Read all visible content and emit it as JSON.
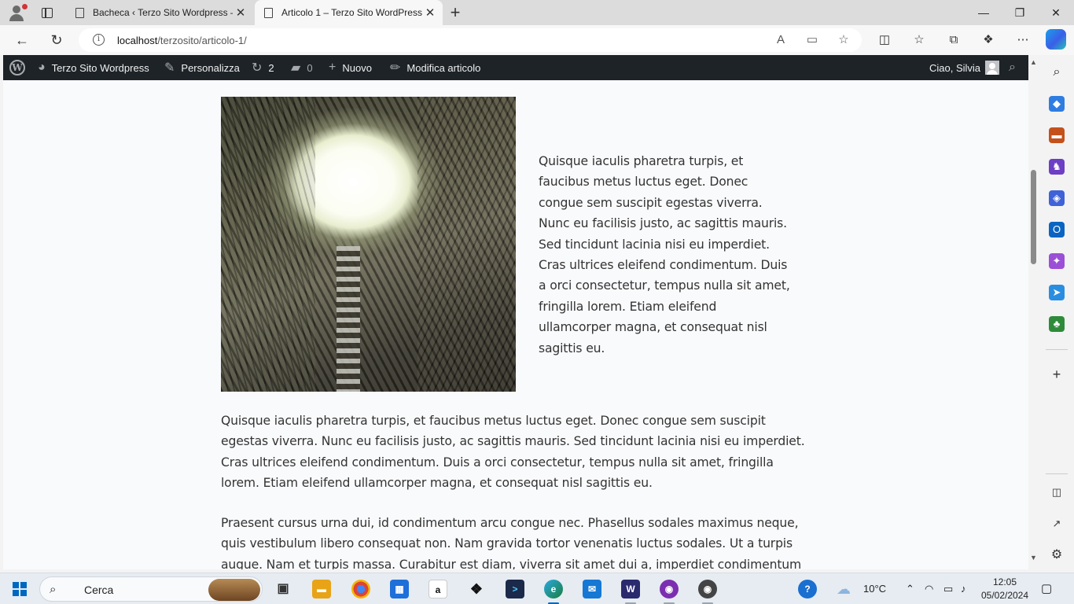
{
  "browser": {
    "tabs": [
      {
        "title": "Bacheca ‹ Terzo Sito Wordpress — "
      },
      {
        "title": "Articolo 1 – Terzo Sito WordPress"
      }
    ],
    "url_host": "localhost",
    "url_path": "/terzosito/articolo-1/"
  },
  "adminbar": {
    "site_name": "Terzo Sito Wordpress",
    "customize": "Personalizza",
    "updates_count": "2",
    "comments_count": "0",
    "new_label": "Nuovo",
    "edit_label": "Modifica articolo",
    "greeting": "Ciao, Silvia"
  },
  "article": {
    "aside_paragraph": "Quisque iaculis pharetra turpis, et faucibus metus luctus eget. Donec congue sem suscipit egestas viverra. Nunc eu facilisis justo, ac sagittis mauris. Sed tincidunt lacinia nisi eu imperdiet. Cras ultrices eleifend condimentum. Duis a orci consectetur, tempus nulla sit amet, fringilla lorem. Etiam eleifend ullamcorper magna, et consequat nisl sagittis eu.",
    "paragraph_1": "Quisque iaculis pharetra turpis, et faucibus metus luctus eget. Donec congue sem suscipit egestas viverra. Nunc eu facilisis justo, ac sagittis mauris. Sed tincidunt lacinia nisi eu imperdiet. Cras ultrices eleifend condimentum. Duis a orci consectetur, tempus nulla sit amet, fringilla lorem. Etiam eleifend ullamcorper magna, et consequat nisl sagittis eu.",
    "paragraph_2": "Praesent cursus urna dui, id condimentum arcu congue nec. Phasellus sodales maximus neque, quis vestibulum libero consequat non. Nam gravida tortor venenatis luctus sodales. Ut a turpis augue. Nam et turpis massa. Curabitur est diam, viverra sit amet dui a, imperdiet condimentum ante. Ut in sollicitudin"
  },
  "taskbar": {
    "search_label": "Cerca",
    "temperature": "10°C",
    "time": "12:05",
    "date": "05/02/2024"
  },
  "colors": {
    "admin_bar_bg": "#1d2327",
    "page_bg": "#f9fafc",
    "taskbar_bg": "#e6ecf2",
    "windows_blue": "#0067c0"
  }
}
